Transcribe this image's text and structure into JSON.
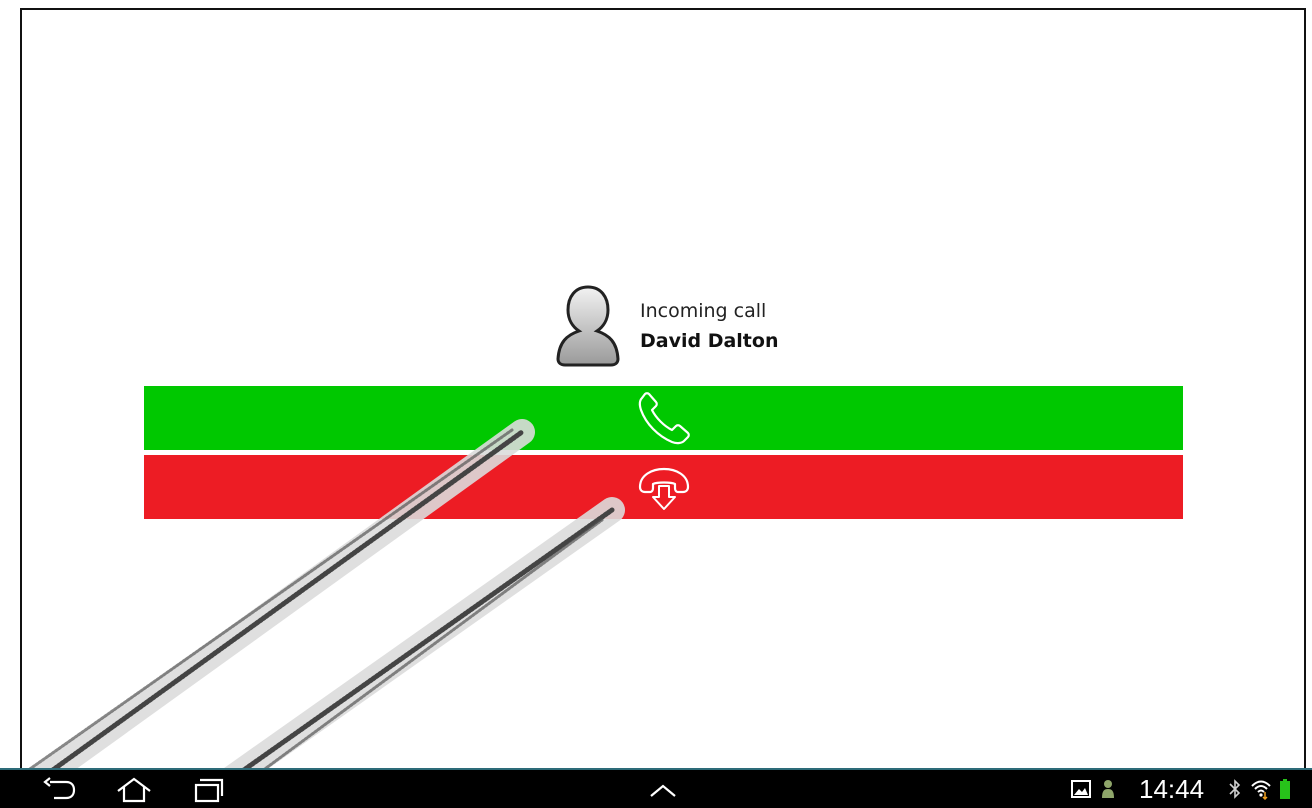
{
  "call": {
    "status_text": "Incoming call",
    "caller_name": "David Dalton"
  },
  "actions": {
    "answer": {
      "icon": "phone-answer-icon",
      "color": "#00c800"
    },
    "decline": {
      "icon": "phone-hangup-icon",
      "color": "#ed1c24"
    }
  },
  "navigation": {
    "buttons": [
      "back-icon",
      "home-icon",
      "recent-apps-icon"
    ],
    "center": "chevron-up-icon"
  },
  "status_bar": {
    "time": "14:44",
    "icons": [
      "gallery-icon",
      "contact-icon",
      "bluetooth-icon",
      "wifi-icon",
      "battery-icon"
    ],
    "accent": "#2d6b78"
  }
}
